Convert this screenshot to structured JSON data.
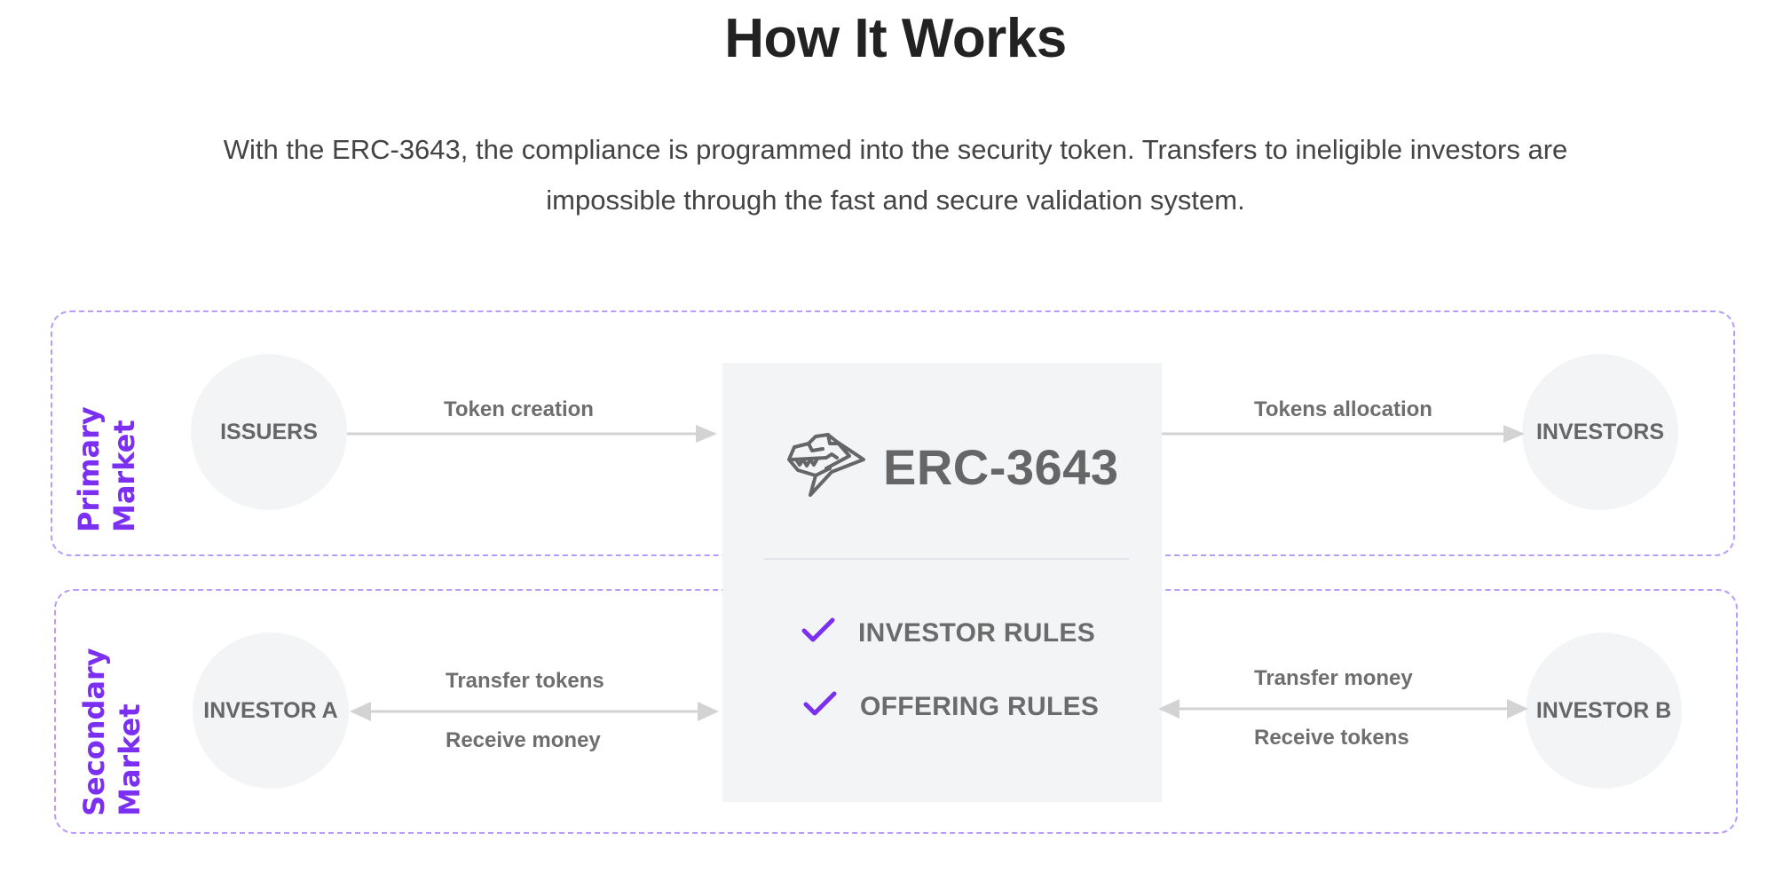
{
  "header": {
    "title": "How It Works",
    "subtitle_line1": "With the ERC-3643, the compliance is programmed into the security token. Transfers to ineligible investors are",
    "subtitle_line2": "impossible through the fast and secure validation system."
  },
  "colors": {
    "accent": "#7b2ff0",
    "dashed_border": "#b89cf7",
    "panel_bg": "#f3f4f6",
    "arrow": "#d3d3d3",
    "text_dark": "#222222",
    "text_gray": "#666666"
  },
  "center": {
    "logo_icon": "dinosaur-head-icon",
    "name": "ERC-3643",
    "rules": [
      {
        "icon": "checkmark-icon",
        "label": "INVESTOR RULES"
      },
      {
        "icon": "checkmark-icon",
        "label": "OFFERING RULES"
      }
    ]
  },
  "primary_market": {
    "label_line1": "Primary",
    "label_line2": "Market",
    "source_node": "ISSUERS",
    "target_node": "INVESTORS",
    "left_edge": {
      "label": "Token creation",
      "direction": "right"
    },
    "right_edge": {
      "label": "Tokens allocation",
      "direction": "right"
    }
  },
  "secondary_market": {
    "label_line1": "Secondary",
    "label_line2": "Market",
    "left_node": "INVESTOR A",
    "right_node": "INVESTOR B",
    "left_edge": {
      "label_top": "Transfer tokens",
      "label_bottom": "Receive money",
      "direction": "both"
    },
    "right_edge": {
      "label_top": "Transfer money",
      "label_bottom": "Receive tokens",
      "direction": "both"
    }
  }
}
